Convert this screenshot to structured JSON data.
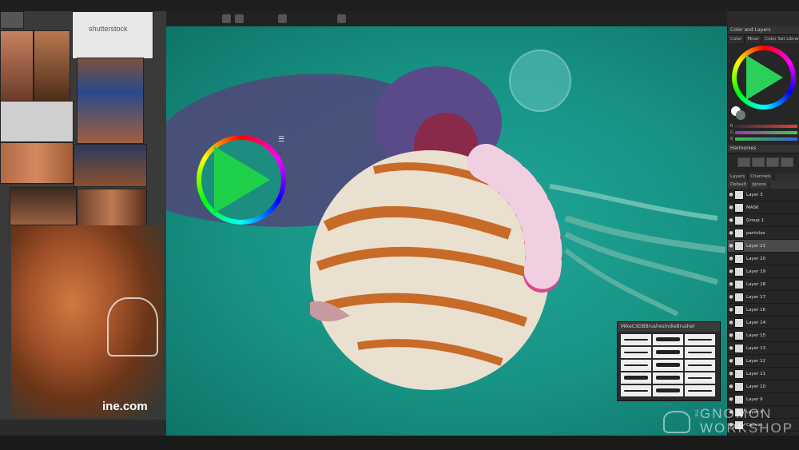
{
  "reference_board": {
    "watermark_text": "shutterstock",
    "caption_text": "ine.com"
  },
  "color_wheel_popup": {
    "menu_icon": "hamburger-icon",
    "selected_color": "#1ed04a"
  },
  "brush_panel": {
    "title": "MikeCSDBBrushesIndieBrusher",
    "more_label": "...",
    "brush_count": 15
  },
  "right_panel": {
    "color_header": "Color and Layers",
    "color_tabs": [
      "Color",
      "Mixer",
      "Color Set Libraries"
    ],
    "slider_labels": [
      "R",
      "G",
      "B"
    ],
    "harmonies_header": "Harmonies",
    "layers_tabs": [
      "Layers",
      "Channels"
    ],
    "blend_mode": "Default",
    "opacity_label": "Ignore",
    "layers": [
      {
        "name": "Layer 3",
        "selected": false
      },
      {
        "name": "MASK",
        "selected": false
      },
      {
        "name": "Group 1",
        "selected": false
      },
      {
        "name": "particles",
        "selected": false
      },
      {
        "name": "Layer 21",
        "selected": true
      },
      {
        "name": "Layer 20",
        "selected": false
      },
      {
        "name": "Layer 19",
        "selected": false
      },
      {
        "name": "Layer 18",
        "selected": false
      },
      {
        "name": "Layer 17",
        "selected": false
      },
      {
        "name": "Layer 16",
        "selected": false
      },
      {
        "name": "Layer 14",
        "selected": false
      },
      {
        "name": "Layer 15",
        "selected": false
      },
      {
        "name": "Layer 13",
        "selected": false
      },
      {
        "name": "Layer 12",
        "selected": false
      },
      {
        "name": "Layer 11",
        "selected": false
      },
      {
        "name": "Layer 10",
        "selected": false
      },
      {
        "name": "Layer 9",
        "selected": false
      },
      {
        "name": "Layer 4",
        "selected": false
      },
      {
        "name": "Canvas",
        "selected": false
      }
    ]
  },
  "watermark": {
    "the": "THE",
    "line1": "GNOMON",
    "line2": "WORKSHOP"
  },
  "colors": {
    "canvas_bg": "#179283",
    "accent_green": "#1ed04a",
    "panel_bg": "#262626"
  }
}
